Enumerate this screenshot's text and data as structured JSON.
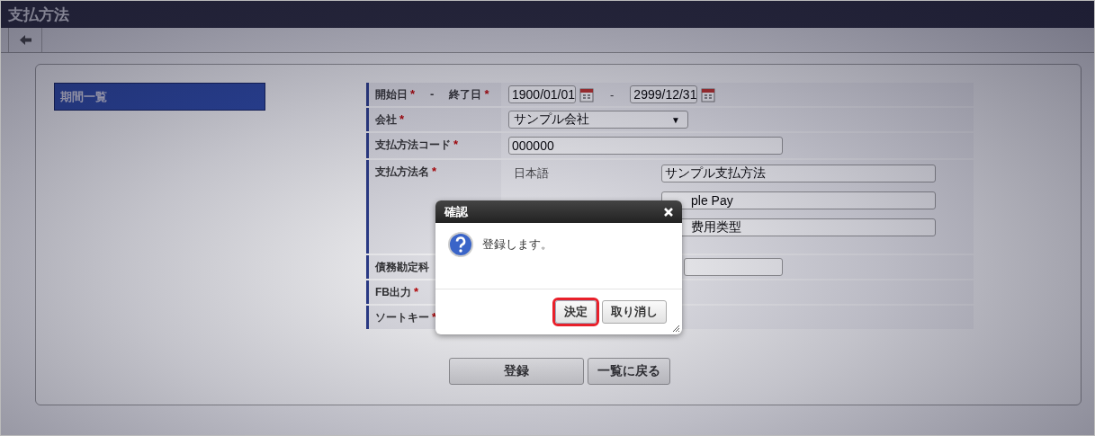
{
  "header": {
    "title": "支払方法"
  },
  "sidebar": {
    "items": [
      {
        "label": "期間一覧",
        "selected": true
      }
    ]
  },
  "form": {
    "rows": [
      {
        "kind": "date_range",
        "label": "開始日",
        "mark": "*",
        "separator": "-",
        "label2": "終了日",
        "mark2": "*",
        "start": "1900/01/01",
        "range_separator": "-",
        "end": "2999/12/31"
      },
      {
        "kind": "select",
        "label": "会社",
        "mark": "*",
        "value": "サンプル会社",
        "arrow": "▼"
      },
      {
        "kind": "text",
        "label": "支払方法コード",
        "mark": "*",
        "value": "000000"
      },
      {
        "kind": "multilang",
        "label": "支払方法名",
        "mark": "*",
        "entries": [
          {
            "lang": "日本語",
            "value": "サンプル支払方法"
          },
          {
            "value": "ple Pay"
          },
          {
            "value": "费用类型"
          }
        ]
      },
      {
        "kind": "short_text",
        "label": "債務勘定科"
      },
      {
        "kind": "label_only",
        "label": "FB出力",
        "mark": "*"
      },
      {
        "kind": "label_only",
        "label": "ソートキー",
        "mark": "*"
      }
    ]
  },
  "actions": [
    "登録",
    "一覧に戻る"
  ],
  "dialog": {
    "title": "確認",
    "message": "登録します。",
    "buttons": [
      {
        "label": "決定",
        "focused": true
      },
      {
        "label": "取り消し",
        "focused": false
      }
    ]
  }
}
